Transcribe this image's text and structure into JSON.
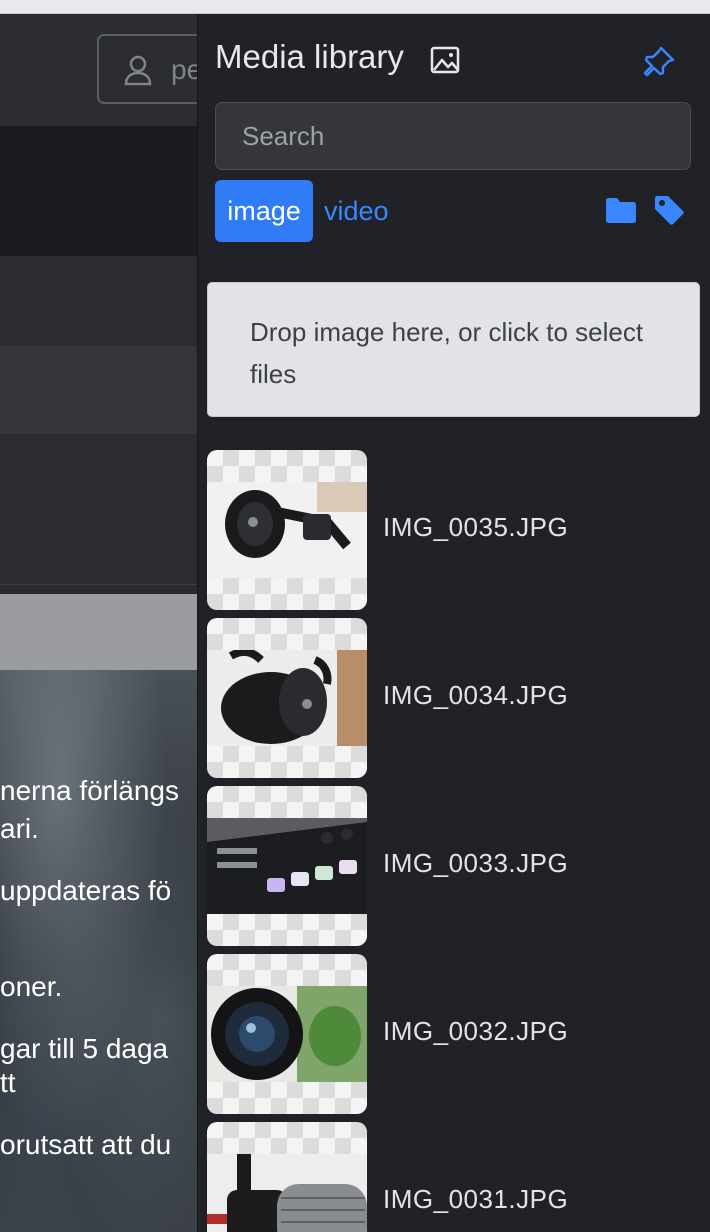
{
  "background_app": {
    "user_field_text": "pe",
    "text_lines": [
      "nerna förlängs",
      "ari.",
      "uppdateras fö",
      "oner.",
      "gar till 5 daga",
      "tt",
      "orutsatt att du"
    ]
  },
  "media_library": {
    "title": "Media library",
    "search_placeholder": "Search",
    "filters": {
      "image_label": "image",
      "video_label": "video"
    },
    "dropzone_text": "Drop image here, or click to select files",
    "items": [
      {
        "name": "IMG_0035.JPG",
        "subject": "headphones"
      },
      {
        "name": "IMG_0034.JPG",
        "subject": "headphones"
      },
      {
        "name": "IMG_0033.JPG",
        "subject": "audio-mixer"
      },
      {
        "name": "IMG_0032.JPG",
        "subject": "camera-lens"
      },
      {
        "name": "IMG_0031.JPG",
        "subject": "microphone"
      }
    ]
  },
  "colors": {
    "accent": "#2f7cf6",
    "link": "#3a86ff",
    "drawer_bg": "#212228"
  },
  "icons": [
    "image-icon",
    "pin-icon",
    "folder-icon",
    "tag-icon",
    "user-icon"
  ]
}
